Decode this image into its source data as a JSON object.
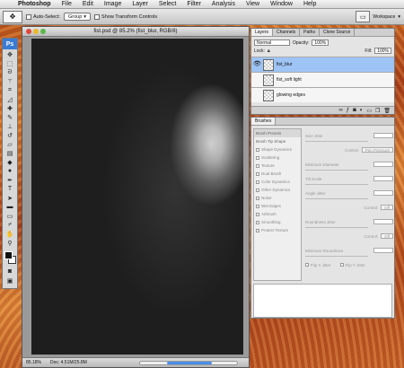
{
  "menubar": {
    "app": "Photoshop",
    "items": [
      "File",
      "Edit",
      "Image",
      "Layer",
      "Select",
      "Filter",
      "Analysis",
      "View",
      "Window",
      "Help"
    ]
  },
  "options": {
    "auto_select": "Auto-Select:",
    "group": "Group",
    "show_transform": "Show Transform Controls",
    "workspace": "Workspace"
  },
  "toolbox": {
    "logo": "Ps",
    "tools": [
      "move",
      "marquee",
      "lasso",
      "magic-wand",
      "crop",
      "slice",
      "healing",
      "brush",
      "stamp",
      "history-brush",
      "eraser",
      "gradient",
      "blur",
      "dodge",
      "pen",
      "type",
      "path-select",
      "shape",
      "notes",
      "eyedropper",
      "hand",
      "zoom"
    ]
  },
  "document": {
    "title": "fist.psd @ 85.2% (fist_blur, RGB/8)",
    "zoom": "85.18%",
    "doc_size": "Doc: 4.51M/25.8M"
  },
  "layers": {
    "tabs": [
      "Layers",
      "Channels",
      "Paths",
      "Clone Source"
    ],
    "blend": "Normal",
    "opacity_label": "Opacity:",
    "opacity": "100%",
    "lock_label": "Lock:",
    "fill_label": "Fill:",
    "fill": "100%",
    "items": [
      {
        "name": "fist_blur",
        "visible": true,
        "selected": true
      },
      {
        "name": "fist_soft light",
        "visible": false,
        "selected": false
      },
      {
        "name": "glowing edges",
        "visible": false,
        "selected": false
      }
    ],
    "footer_icons": [
      "link-icon",
      "fx-icon",
      "mask-icon",
      "adjustment-icon",
      "folder-icon",
      "new-layer-icon",
      "trash-icon"
    ]
  },
  "brushes": {
    "tab": "Brushes",
    "list": [
      {
        "label": "Brush Presets",
        "head": true
      },
      {
        "label": "Brush Tip Shape",
        "head": true
      },
      {
        "label": "Shape Dynamics"
      },
      {
        "label": "Scattering"
      },
      {
        "label": "Texture"
      },
      {
        "label": "Dual Brush"
      },
      {
        "label": "Color Dynamics"
      },
      {
        "label": "Other Dynamics"
      },
      {
        "label": "Noise"
      },
      {
        "label": "Wet Edges"
      },
      {
        "label": "Airbrush"
      },
      {
        "label": "Smoothing"
      },
      {
        "label": "Protect Texture"
      }
    ],
    "settings": {
      "size_jitter": "Size Jitter",
      "control": "Control:",
      "pen_pressure": "Pen Pressure",
      "min_diameter": "Minimum Diameter",
      "tilt_scale": "Tilt Scale",
      "angle_jitter": "Angle Jitter",
      "off": "Off",
      "roundness_jitter": "Roundness Jitter",
      "min_roundness": "Minimum Roundness",
      "flip_x": "Flip X Jitter",
      "flip_y": "Flip Y Jitter"
    }
  }
}
